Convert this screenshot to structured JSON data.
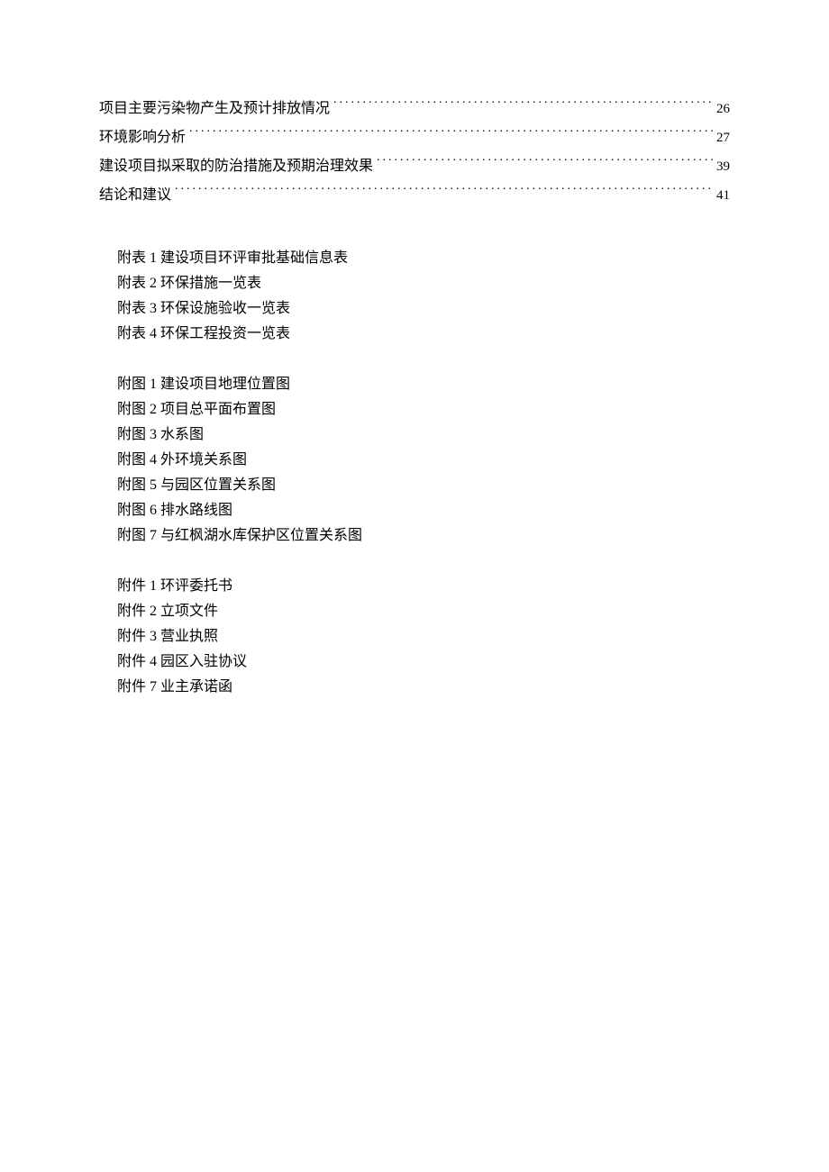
{
  "toc": [
    {
      "title": "项目主要污染物产生及预计排放情况",
      "page": "26"
    },
    {
      "title": "环境影响分析",
      "page": "27"
    },
    {
      "title": "建设项目拟采取的防治措施及预期治理效果",
      "page": "39"
    },
    {
      "title": "结论和建议",
      "page": "41"
    }
  ],
  "groups": [
    {
      "name": "tables",
      "items": [
        {
          "prefix": "附表 1",
          "text": "建设项目环评审批基础信息表"
        },
        {
          "prefix": "附表 2",
          "text": "环保措施一览表"
        },
        {
          "prefix": "附表 3",
          "text": "环保设施验收一览表"
        },
        {
          "prefix": "附表 4",
          "text": "环保工程投资一览表"
        }
      ]
    },
    {
      "name": "figures",
      "items": [
        {
          "prefix": "附图 1",
          "text": "建设项目地理位置图"
        },
        {
          "prefix": "附图 2",
          "text": "项目总平面布置图"
        },
        {
          "prefix": "附图 3",
          "text": "水系图"
        },
        {
          "prefix": "附图 4",
          "text": "外环境关系图"
        },
        {
          "prefix": "附图 5",
          "text": "与园区位置关系图"
        },
        {
          "prefix": "附图 6",
          "text": "排水路线图"
        },
        {
          "prefix": "附图 7",
          "text": "与红枫湖水库保护区位置关系图"
        }
      ]
    },
    {
      "name": "attachments",
      "items": [
        {
          "prefix": "附件 1",
          "text": "环评委托书"
        },
        {
          "prefix": "附件 2",
          "text": "立项文件"
        },
        {
          "prefix": "附件 3",
          "text": "营业执照"
        },
        {
          "prefix": "附件 4",
          "text": "园区入驻协议"
        },
        {
          "prefix": "附件 7",
          "text": "业主承诺函"
        }
      ]
    }
  ]
}
